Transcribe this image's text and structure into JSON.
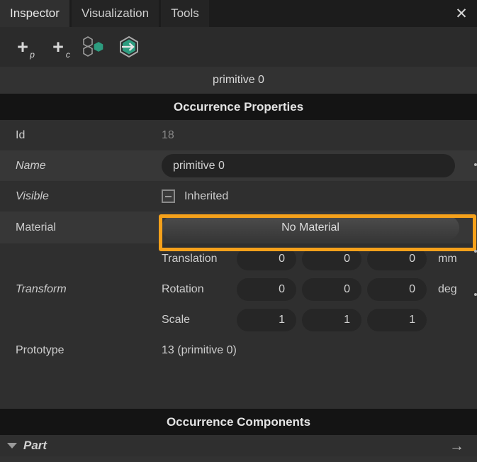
{
  "window": {
    "close_label": "✕"
  },
  "tabs": [
    {
      "label": "Inspector",
      "selected": true
    },
    {
      "label": "Visualization",
      "selected": false
    },
    {
      "label": "Tools",
      "selected": false
    }
  ],
  "toolbar": {
    "add_prototype": {
      "glyph": "+",
      "sub": "p",
      "name": "add-prototype-icon"
    },
    "add_child": {
      "glyph": "+",
      "sub": "c",
      "name": "add-component-icon"
    },
    "hex_cluster": {
      "name": "hexagon-cluster-icon"
    },
    "hex_import": {
      "name": "hexagon-import-icon"
    },
    "accent_green": "#2d9c7f"
  },
  "title": "primitive 0",
  "sections": {
    "properties_header": "Occurrence Properties",
    "components_header": "Occurrence Components"
  },
  "properties": {
    "id": {
      "label": "Id",
      "value": "18"
    },
    "name": {
      "label": "Name",
      "value": "primitive 0",
      "placeholder": "Name"
    },
    "visible": {
      "label": "Visible",
      "state_label": "Inherited",
      "checkbox_state": "indeterminate"
    },
    "material": {
      "label": "Material",
      "value": "No Material"
    },
    "transform": {
      "label": "Transform",
      "rows": [
        {
          "name": "Translation",
          "values": [
            "0",
            "0",
            "0"
          ],
          "unit": "mm"
        },
        {
          "name": "Rotation",
          "values": [
            "0",
            "0",
            "0"
          ],
          "unit": "deg"
        },
        {
          "name": "Scale",
          "values": [
            "1",
            "1",
            "1"
          ],
          "unit": ""
        }
      ]
    },
    "prototype": {
      "label": "Prototype",
      "value": "13 (primitive 0)"
    }
  },
  "components": [
    {
      "label": "Part",
      "expanded": true,
      "action_glyph": "→"
    }
  ],
  "annotation": {
    "highlight_color": "#f5a11b",
    "target": "material-button"
  }
}
